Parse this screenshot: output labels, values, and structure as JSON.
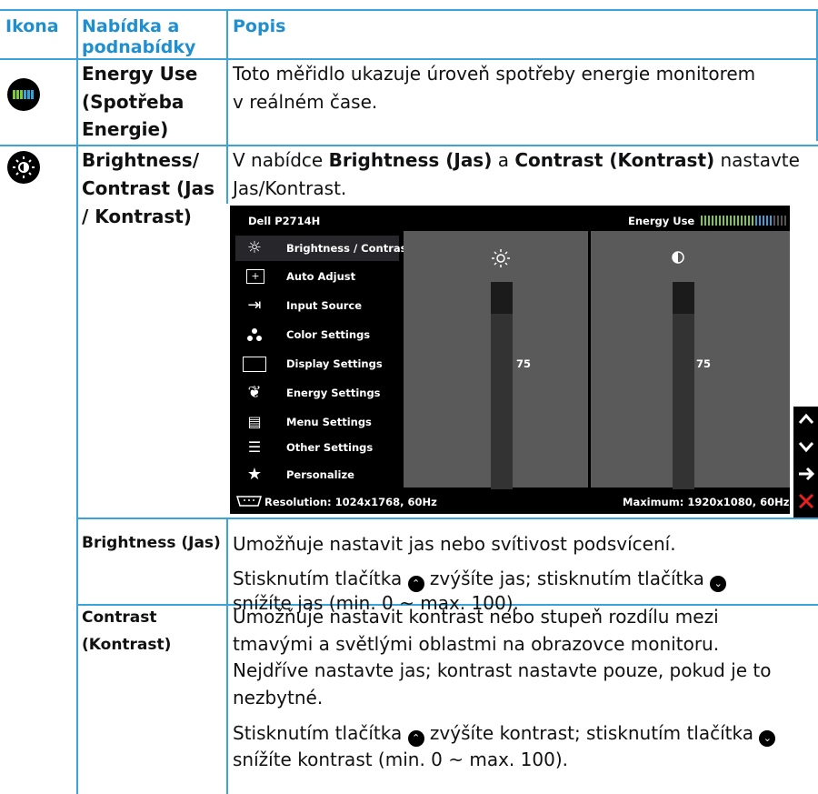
{
  "headers": {
    "icon": "Ikona",
    "menu_l1": "Nabídka a",
    "menu_l2": "podnabídky",
    "desc": "Popis"
  },
  "row_energy": {
    "name_lines": [
      "Energy Use",
      "(Spotřeba",
      "Energie)"
    ],
    "desc_lines": [
      "Toto měřidlo ukazuje úroveň spotřeby energie monitorem",
      "v reálném čase."
    ],
    "icon": "energy-meter-icon"
  },
  "row_brightness": {
    "name_lines": [
      "Brightness/",
      "Contrast (Jas",
      "/ Kontrast)"
    ],
    "desc_l1_pre": "V nabídce ",
    "desc_l1_b1": "Brightness (Jas)",
    "desc_l1_mid": " a ",
    "desc_l1_b2": "Contrast (Kontrast)",
    "desc_l1_post": " nastavte",
    "desc_l2": "Jas/Kontrast.",
    "icon": "brightness-sun-icon"
  },
  "osd": {
    "model": "Dell P2714H",
    "energy_label": "Energy Use",
    "menu": [
      {
        "label": "Brightness / Contrast",
        "icon": "brightness-icon",
        "glyph": "☼"
      },
      {
        "label": "Auto Adjust",
        "icon": "auto-adjust-icon",
        "glyph": "[+]"
      },
      {
        "label": "Input Source",
        "icon": "input-source-icon",
        "glyph": "⇥"
      },
      {
        "label": "Color Settings",
        "icon": "color-dots-icon",
        "glyph": "•"
      },
      {
        "label": "Display Settings",
        "icon": "display-icon",
        "glyph": "▭"
      },
      {
        "label": "Energy Settings",
        "icon": "leaf-icon",
        "glyph": "❦"
      },
      {
        "label": "Menu Settings",
        "icon": "menu-settings-icon",
        "glyph": "▤"
      },
      {
        "label": "Other Settings",
        "icon": "sliders-icon",
        "glyph": "☰"
      },
      {
        "label": "Personalize",
        "icon": "star-icon",
        "glyph": "★"
      }
    ],
    "brightness_value": "75",
    "contrast_value": "75",
    "brightness_level": 75,
    "contrast_level": 75,
    "resolution": "Resolution: 1024x1768, 60Hz",
    "maximum": "Maximum: 1920x1080, 60Hz",
    "nav_buttons": [
      {
        "icon": "up-arrow-icon",
        "glyph": "∧"
      },
      {
        "icon": "down-arrow-icon",
        "glyph": "∨"
      },
      {
        "icon": "right-arrow-icon",
        "glyph": "→"
      },
      {
        "icon": "close-icon",
        "glyph": "✕"
      }
    ]
  },
  "row_bright_sub": {
    "name": "Brightness (Jas)",
    "line1": "Umožňuje nastavit jas nebo svítivost podsvícení.",
    "line2_a": "Stisknutím tlačítka ",
    "line2_b": " zvýšíte jas; stisknutím tlačítka ",
    "line3": "snížíte jas (min. 0 ~ max. 100)."
  },
  "row_contrast_sub": {
    "name_lines": [
      "Contrast",
      "(Kontrast)"
    ],
    "lines": [
      "Umožňuje nastavit kontrast nebo stupeň rozdílu mezi",
      "tmavými a světlými oblastmi na obrazovce monitoru.",
      "Nejdříve nastavte jas; kontrast nastavte pouze, pokud je to",
      "nezbytné."
    ],
    "line5_a": "Stisknutím tlačítka ",
    "line5_b": " zvýšíte kontrast; stisknutím tlačítka ",
    "line6": "snížíte kontrast (min. 0 ~ max. 100)."
  }
}
